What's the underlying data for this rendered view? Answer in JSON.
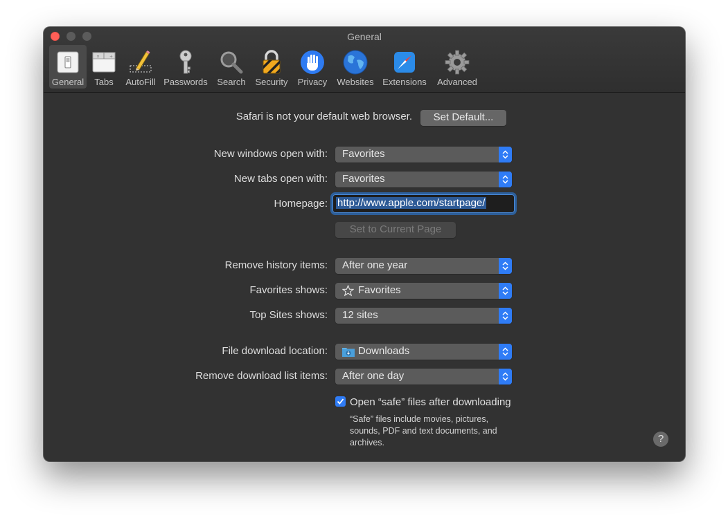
{
  "window": {
    "title": "General"
  },
  "toolbar": {
    "tabs": [
      {
        "label": "General",
        "icon": "general-switch-icon",
        "selected": true
      },
      {
        "label": "Tabs",
        "icon": "tabs-icon"
      },
      {
        "label": "AutoFill",
        "icon": "autofill-pencil-icon"
      },
      {
        "label": "Passwords",
        "icon": "key-icon"
      },
      {
        "label": "Search",
        "icon": "magnifier-icon"
      },
      {
        "label": "Security",
        "icon": "lock-icon"
      },
      {
        "label": "Privacy",
        "icon": "hand-icon"
      },
      {
        "label": "Websites",
        "icon": "globe-icon"
      },
      {
        "label": "Extensions",
        "icon": "compass-icon"
      },
      {
        "label": "Advanced",
        "icon": "gear-icon"
      }
    ]
  },
  "default_browser": {
    "message": "Safari is not your default web browser.",
    "button": "Set Default..."
  },
  "new_windows": {
    "label": "New windows open with:",
    "value": "Favorites"
  },
  "new_tabs": {
    "label": "New tabs open with:",
    "value": "Favorites"
  },
  "homepage": {
    "label": "Homepage:",
    "value": "http://www.apple.com/startpage/",
    "set_current_button": "Set to Current Page"
  },
  "remove_history": {
    "label": "Remove history items:",
    "value": "After one year"
  },
  "favorites_shows": {
    "label": "Favorites shows:",
    "value": "Favorites",
    "icon": "star-icon"
  },
  "top_sites": {
    "label": "Top Sites shows:",
    "value": "12 sites"
  },
  "download_location": {
    "label": "File download location:",
    "value": "Downloads",
    "icon": "downloads-folder-icon"
  },
  "remove_downloads": {
    "label": "Remove download list items:",
    "value": "After one day"
  },
  "open_safe": {
    "label": "Open “safe” files after downloading",
    "checked": true,
    "note_line1": "“Safe” files include movies, pictures,",
    "note_line2": "sounds, PDF and text documents, and",
    "note_line3": "archives."
  },
  "help": {
    "label": "?"
  },
  "colors": {
    "accent": "#2f7cf6",
    "window_bg": "#323232",
    "close": "#ff5f57"
  }
}
